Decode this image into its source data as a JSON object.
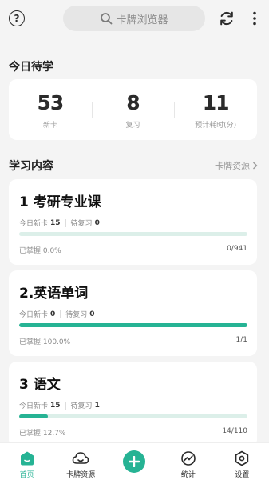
{
  "header": {
    "help_icon": "question-circle-icon",
    "search_placeholder": "卡牌浏览器",
    "sync_icon": "sync-icon",
    "more_icon": "more-vertical-icon"
  },
  "today": {
    "title": "今日待学",
    "stats": [
      {
        "value": "53",
        "label": "新卡"
      },
      {
        "value": "8",
        "label": "复习"
      },
      {
        "value": "11",
        "label": "预计耗时(分)"
      }
    ]
  },
  "content": {
    "title": "学习内容",
    "resource_link": "卡牌资源"
  },
  "courses": [
    {
      "title": "1 考研专业课",
      "new_label": "今日新卡",
      "new_count": "15",
      "review_label": "待复习",
      "review_count": "0",
      "mastered": "已掌握 0.0%",
      "progress": 0.0,
      "count": "0/941"
    },
    {
      "title": "2.英语单词",
      "new_label": "今日新卡",
      "new_count": "0",
      "review_label": "待复习",
      "review_count": "0",
      "mastered": "已掌握 100.0%",
      "progress": 1.0,
      "count": "1/1"
    },
    {
      "title": "3 语文",
      "new_label": "今日新卡",
      "new_count": "15",
      "review_label": "待复习",
      "review_count": "1",
      "mastered": "已掌握 12.7%",
      "progress": 0.127,
      "count": "14/110"
    }
  ],
  "nav": [
    {
      "label": "首页",
      "icon": "home-icon",
      "active": true
    },
    {
      "label": "卡牌资源",
      "icon": "cloud-icon",
      "active": false
    },
    {
      "label": "",
      "icon": "add-icon",
      "active": false
    },
    {
      "label": "统计",
      "icon": "stats-icon",
      "active": false
    },
    {
      "label": "设置",
      "icon": "settings-icon",
      "active": false
    }
  ],
  "colors": {
    "accent": "#26b394",
    "track": "#dcefe9",
    "background": "#f4f4f4"
  }
}
